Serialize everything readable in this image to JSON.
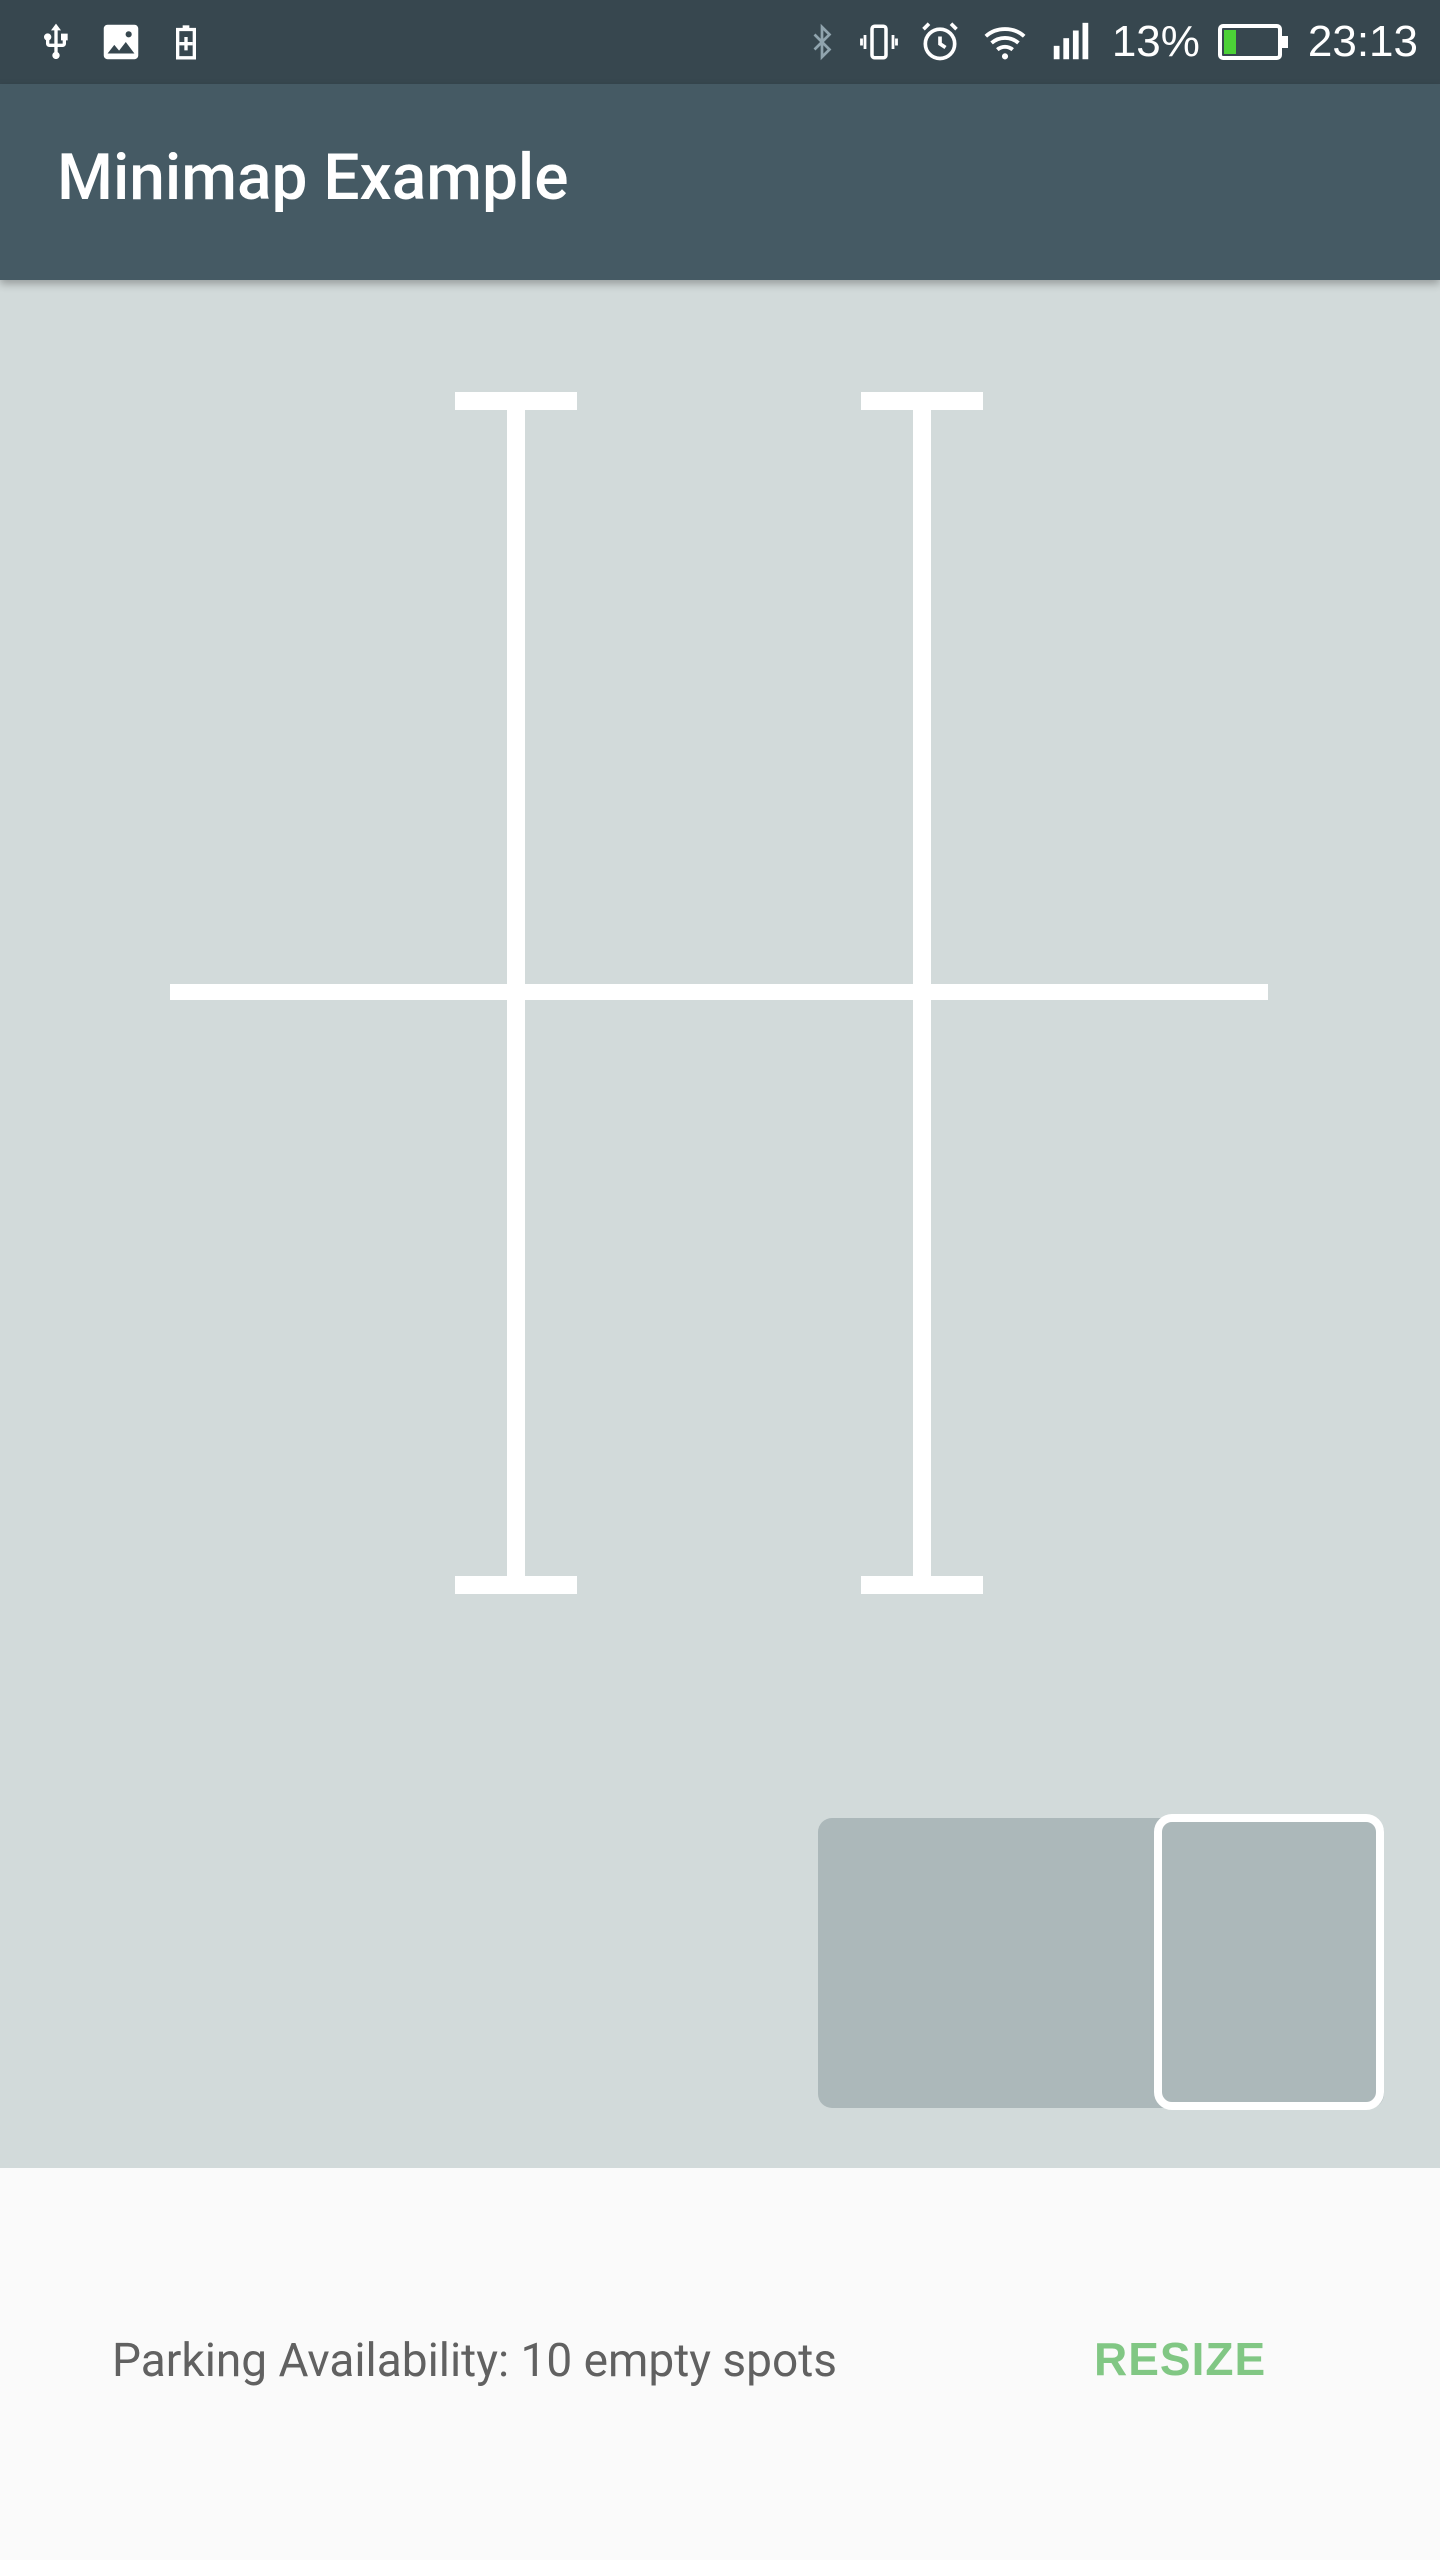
{
  "status_bar": {
    "left_icons": [
      "usb-icon",
      "image-icon",
      "battery-saver-icon"
    ],
    "right_icons": [
      "bluetooth-icon",
      "vibrate-icon",
      "alarm-icon",
      "wifi-icon",
      "signal-icon",
      "battery-icon"
    ],
    "battery_percent": "13%",
    "time": "23:13"
  },
  "app_bar": {
    "title": "Minimap Example"
  },
  "map": {
    "road_color": "#ffffff",
    "background_color": "#d2dada"
  },
  "minimap": {
    "background_color": "#acb8ba",
    "viewport_border_color": "#ffffff"
  },
  "bottom": {
    "availability_text": "Parking Availability: 10 empty spots",
    "resize_label": "RESIZE",
    "resize_color": "#81c784"
  }
}
